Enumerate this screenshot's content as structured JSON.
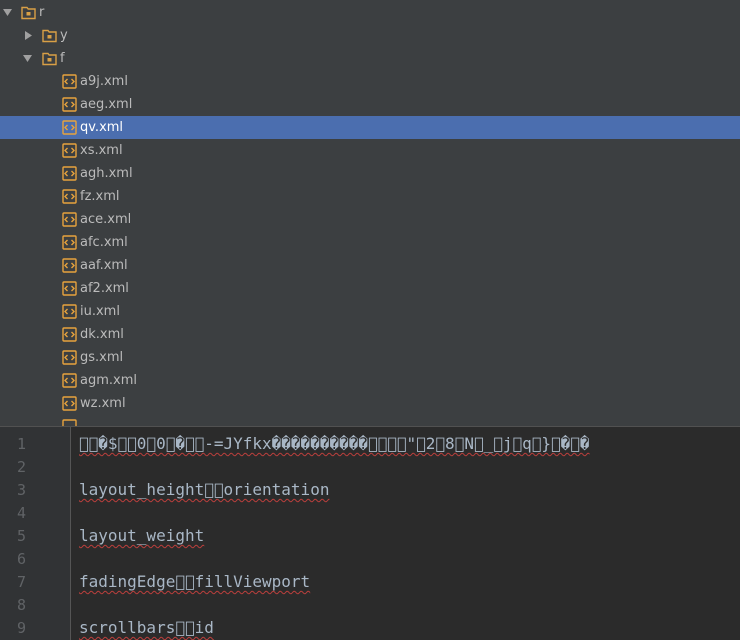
{
  "tree": {
    "root": {
      "label": "r",
      "expanded": true,
      "icon": "folder-icon"
    },
    "folders": [
      {
        "label": "y",
        "expanded": false,
        "icon": "folder-icon"
      },
      {
        "label": "f",
        "expanded": true,
        "icon": "folder-icon"
      }
    ],
    "files": [
      {
        "label": "a9j.xml",
        "icon": "xml-file-icon"
      },
      {
        "label": "aeg.xml",
        "icon": "xml-file-icon"
      },
      {
        "label": "qv.xml",
        "icon": "xml-file-icon",
        "selected": true
      },
      {
        "label": "xs.xml",
        "icon": "xml-file-icon"
      },
      {
        "label": "agh.xml",
        "icon": "xml-file-icon"
      },
      {
        "label": "fz.xml",
        "icon": "xml-file-icon"
      },
      {
        "label": "ace.xml",
        "icon": "xml-file-icon"
      },
      {
        "label": "afc.xml",
        "icon": "xml-file-icon"
      },
      {
        "label": "aaf.xml",
        "icon": "xml-file-icon"
      },
      {
        "label": "af2.xml",
        "icon": "xml-file-icon"
      },
      {
        "label": "iu.xml",
        "icon": "xml-file-icon"
      },
      {
        "label": "dk.xml",
        "icon": "xml-file-icon"
      },
      {
        "label": "gs.xml",
        "icon": "xml-file-icon"
      },
      {
        "label": "agm.xml",
        "icon": "xml-file-icon"
      },
      {
        "label": "wz.xml",
        "icon": "xml-file-icon"
      }
    ]
  },
  "editor": {
    "lines": [
      {
        "number": "1",
        "text": "\u0000\u0000�$\u0000\u00000\u00000\u0000�\u0000\u0000-=JYfkx����������\u0000\u0000\u0000\u0000\"\u00002\u00008\u0000N\u0000_\u0000j\u0000q\u0000}\u0000�\u0000�"
      },
      {
        "number": "2",
        "text": ""
      },
      {
        "number": "3",
        "text": "layout_height\u0000\u0000orientation"
      },
      {
        "number": "4",
        "text": ""
      },
      {
        "number": "5",
        "text": "layout_weight"
      },
      {
        "number": "6",
        "text": ""
      },
      {
        "number": "7",
        "text": "fadingEdge\u0000\u0000fillViewport"
      },
      {
        "number": "8",
        "text": ""
      },
      {
        "number": "9",
        "text": "scrollbars\u0000\u0000id"
      }
    ]
  },
  "colors": {
    "tree_background": "#3c3f41",
    "selection": "#4b6eaf",
    "editor_background": "#2b2b2b",
    "gutter_background": "#313335",
    "code_text": "#a9b7c6",
    "line_number": "#606366",
    "error_underline": "#bc3f3c",
    "folder_icon": "#d9a046",
    "file_icon": "#e8a33d"
  }
}
